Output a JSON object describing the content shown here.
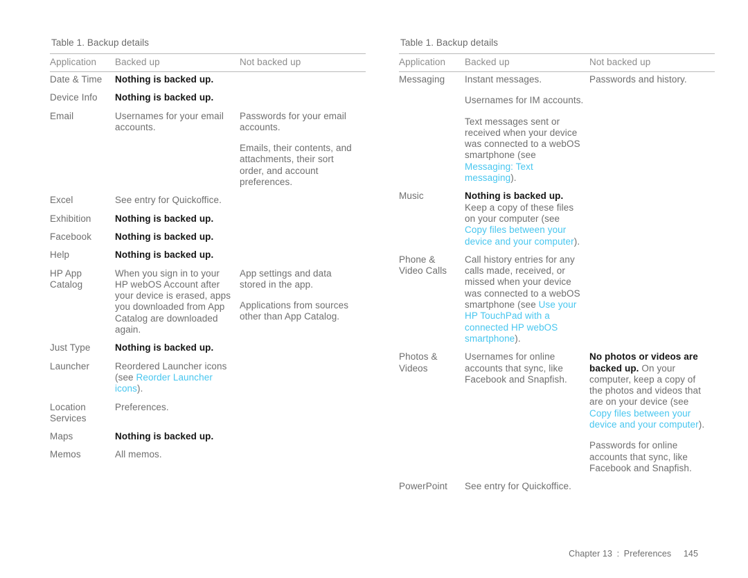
{
  "colors": {
    "body_text": "#6e6e6e",
    "header_text": "#8c8c8c",
    "bold_text": "#141414",
    "link": "#47c6ef",
    "rule": "#b9b9b9",
    "page_background": "#ffffff"
  },
  "footer": {
    "chapter": "Chapter 13",
    "separator": ":",
    "section": "Preferences",
    "page_number": "145"
  },
  "left_table": {
    "caption": "Table 1.  Backup details",
    "columns": [
      "Application",
      "Backed up",
      "Not backed up"
    ],
    "rows": [
      {
        "application": "Date & Time",
        "backed_up": [
          {
            "text": "Nothing is backed up.",
            "bold": true
          }
        ],
        "not_backed_up": []
      },
      {
        "application": "Device Info",
        "backed_up": [
          {
            "text": "Nothing is backed up.",
            "bold": true
          }
        ],
        "not_backed_up": []
      },
      {
        "application": "Email",
        "backed_up": [
          {
            "text": "Usernames for your email accounts."
          }
        ],
        "not_backed_up": [
          {
            "text": "Passwords for your email accounts."
          },
          {
            "text": "Emails, their contents, and attachments, their sort order, and account preferences."
          }
        ]
      },
      {
        "application": "Excel",
        "backed_up": [
          {
            "text": "See entry for Quickoffice."
          }
        ],
        "not_backed_up": []
      },
      {
        "application": "Exhibition",
        "backed_up": [
          {
            "text": "Nothing is backed up.",
            "bold": true
          }
        ],
        "not_backed_up": []
      },
      {
        "application": "Facebook",
        "backed_up": [
          {
            "text": "Nothing is backed up.",
            "bold": true
          }
        ],
        "not_backed_up": []
      },
      {
        "application": "Help",
        "backed_up": [
          {
            "text": "Nothing is backed up.",
            "bold": true
          }
        ],
        "not_backed_up": []
      },
      {
        "application": "HP App Catalog",
        "backed_up": [
          {
            "text": "When you sign in to your HP webOS Account after your device is erased, apps you downloaded from App Catalog are downloaded again."
          }
        ],
        "not_backed_up": [
          {
            "text": "App settings and data stored in the app."
          },
          {
            "text": "Applications from sources other than App Catalog."
          }
        ]
      },
      {
        "application": "Just Type",
        "backed_up": [
          {
            "text": "Nothing is backed up.",
            "bold": true
          }
        ],
        "not_backed_up": []
      },
      {
        "application": "Launcher",
        "backed_up": [
          {
            "prefix": "Reordered Launcher icons (see ",
            "link": "Reorder Launcher icons",
            "suffix": ")."
          }
        ],
        "not_backed_up": []
      },
      {
        "application": "Location Services",
        "backed_up": [
          {
            "text": "Preferences."
          }
        ],
        "not_backed_up": []
      },
      {
        "application": "Maps",
        "backed_up": [
          {
            "text": "Nothing is backed up.",
            "bold": true
          }
        ],
        "not_backed_up": []
      },
      {
        "application": "Memos",
        "backed_up": [
          {
            "text": "All memos."
          }
        ],
        "not_backed_up": []
      }
    ]
  },
  "right_table": {
    "caption": "Table 1.  Backup details",
    "columns": [
      "Application",
      "Backed up",
      "Not backed up"
    ],
    "rows": [
      {
        "application": "Messaging",
        "backed_up": [
          {
            "text": "Instant messages."
          },
          {
            "text": "Usernames for IM accounts."
          },
          {
            "prefix": "Text messages sent or received when your device was connected to a webOS smartphone (see ",
            "link": "Messaging: Text messaging",
            "suffix": ")."
          }
        ],
        "not_backed_up": [
          {
            "text": "Passwords and history."
          }
        ]
      },
      {
        "application": "Music",
        "backed_up": [
          {
            "text": "Nothing is backed up.",
            "bold": true,
            "tight": true
          },
          {
            "prefix": "Keep a copy of these files on your computer (see ",
            "link": "Copy files between your device and your computer",
            "suffix": ")."
          }
        ],
        "not_backed_up": []
      },
      {
        "application": "Phone & Video Calls",
        "backed_up": [
          {
            "prefix": "Call history entries for any calls made, received, or missed when your device was connected to a webOS smartphone (see ",
            "link": "Use your HP TouchPad with a connected HP webOS smartphone",
            "suffix": ")."
          }
        ],
        "not_backed_up": []
      },
      {
        "application": "Photos & Videos",
        "backed_up": [
          {
            "text": "Usernames for online accounts that sync, like Facebook and Snapfish."
          }
        ],
        "not_backed_up": [
          {
            "bold_lead": "No photos or videos are backed up.",
            "prefix": " On your computer, keep a copy of the photos and videos that are on your device (see ",
            "link": "Copy files between your device and your computer",
            "suffix": ")."
          },
          {
            "text": "Passwords for online accounts that sync, like Facebook and Snapfish."
          }
        ]
      },
      {
        "application": "PowerPoint",
        "backed_up": [
          {
            "text": "See entry for Quickoffice."
          }
        ],
        "not_backed_up": []
      }
    ]
  }
}
